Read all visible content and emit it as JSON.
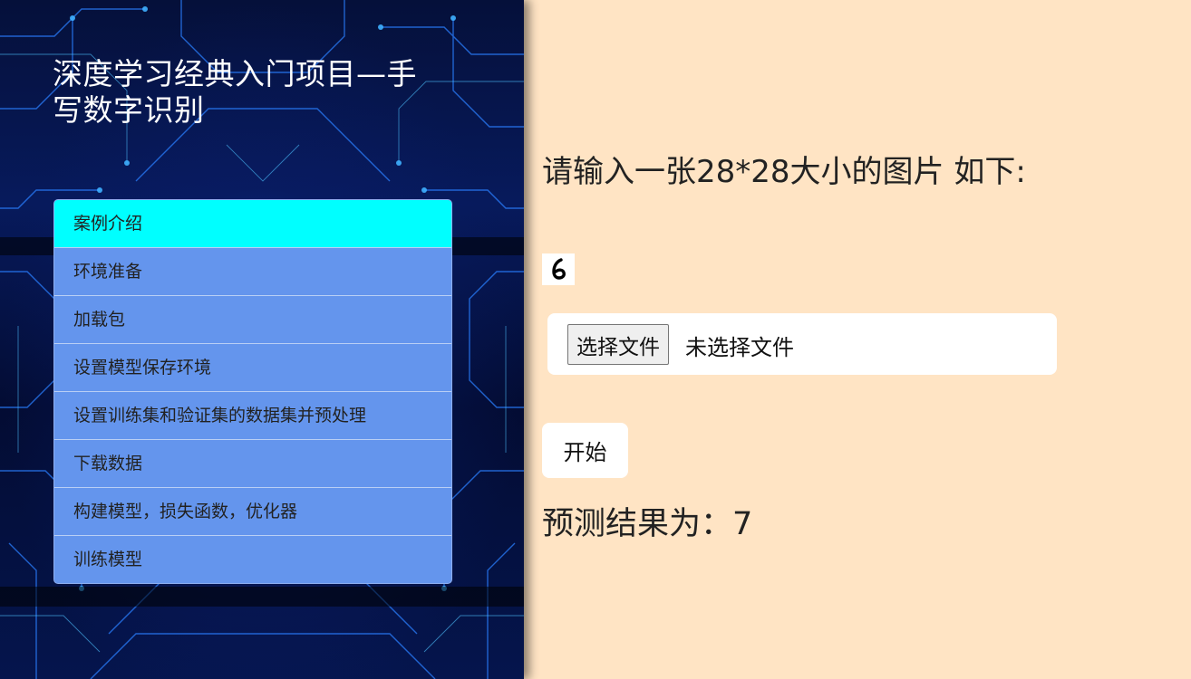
{
  "sidebar": {
    "title": "深度学习经典入门项目—手写数字识别",
    "items": [
      {
        "label": "案例介绍",
        "active": true
      },
      {
        "label": "环境准备",
        "active": false
      },
      {
        "label": "加载包",
        "active": false
      },
      {
        "label": "设置模型保存环境",
        "active": false
      },
      {
        "label": "设置训练集和验证集的数据集并预处理",
        "active": false
      },
      {
        "label": "下载数据",
        "active": false
      },
      {
        "label": "构建模型，损失函数，优化器",
        "active": false
      },
      {
        "label": "训练模型",
        "active": false
      }
    ]
  },
  "main": {
    "prompt": "请输入一张28*28大小的图片 如下:",
    "file_button_label": "选择文件",
    "file_status": "未选择文件",
    "start_label": "开始",
    "result_text": "预测结果为：7"
  },
  "colors": {
    "active_item": "#00ffff",
    "nav_item": "#6495ed",
    "main_bg": "#ffe4c4"
  },
  "icons": {
    "sample_digit": "handwritten-digit-sample-icon"
  }
}
